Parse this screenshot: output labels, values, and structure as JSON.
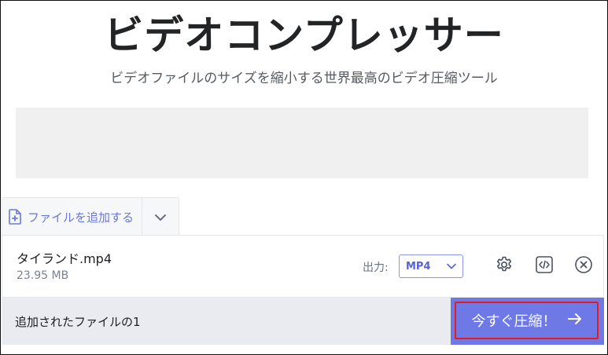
{
  "header": {
    "title": "ビデオコンプレッサー",
    "subtitle": "ビデオファイルのサイズを縮小する世界最高のビデオ圧縮ツール"
  },
  "uploader": {
    "add_file_label": "ファイルを追加する",
    "add_icon": "file-plus-icon",
    "dropdown_icon": "chevron-down-icon"
  },
  "file": {
    "name": "タイランド.mp4",
    "size": "23.95 MB",
    "output_label": "出力:",
    "format": "MP4",
    "actions": [
      "gear-icon",
      "code-icon",
      "close-circle-icon"
    ]
  },
  "footer": {
    "added_text": "追加されたファイルの1",
    "compress_label": "今すぐ圧縮！",
    "compress_icon": "arrow-right-icon"
  },
  "colors": {
    "accent": "#6f79e6",
    "highlight_border": "#e31d1d",
    "bar_bg": "#e9ebf1"
  }
}
